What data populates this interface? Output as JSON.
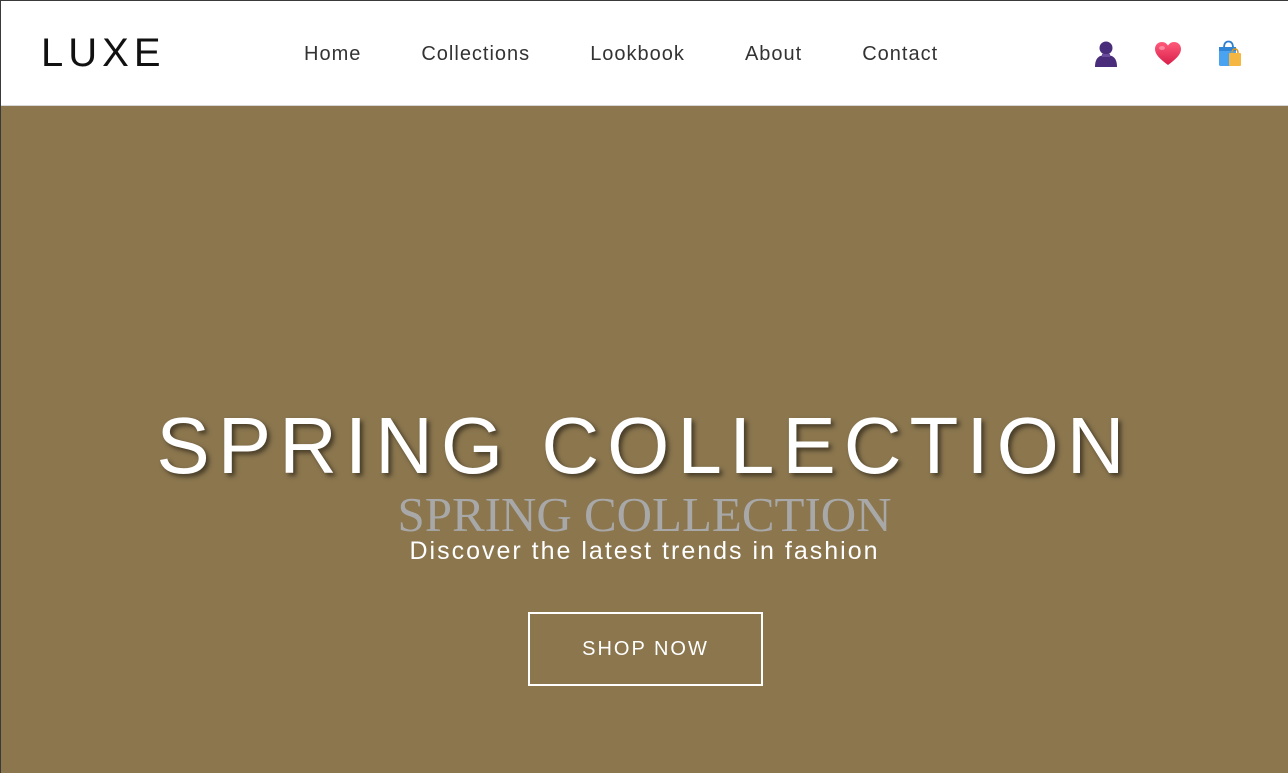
{
  "brand": {
    "logo_text": "LUXE"
  },
  "nav": {
    "items": [
      {
        "label": "Home"
      },
      {
        "label": "Collections"
      },
      {
        "label": "Lookbook"
      },
      {
        "label": "About"
      },
      {
        "label": "Contact"
      }
    ]
  },
  "header_icons": [
    {
      "name": "user-icon",
      "color": "#4a2d7a"
    },
    {
      "name": "heart-icon",
      "color": "#e8315a"
    },
    {
      "name": "shopping-bag-icon",
      "color": "#3d9be9"
    }
  ],
  "hero": {
    "title": "SPRING COLLECTION",
    "title_echo": "SPRING COLLECTION",
    "tagline": "Discover the latest trends in fashion",
    "cta_label": "SHOP NOW",
    "background_color": "#8b764e",
    "text_color": "#ffffff",
    "echo_color": "#a8a8a8"
  }
}
